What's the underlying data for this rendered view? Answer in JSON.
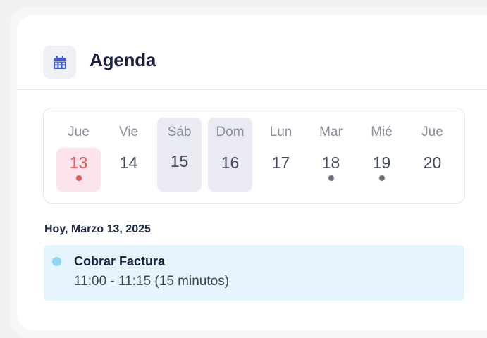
{
  "header": {
    "title": "Agenda",
    "icon": "calendar-icon"
  },
  "week": {
    "days": [
      {
        "dow": "Jue",
        "num": "13",
        "today": true,
        "event": true
      },
      {
        "dow": "Vie",
        "num": "14"
      },
      {
        "dow": "Sáb",
        "num": "15",
        "selected": true
      },
      {
        "dow": "Dom",
        "num": "16",
        "selected": true
      },
      {
        "dow": "Lun",
        "num": "17"
      },
      {
        "dow": "Mar",
        "num": "18",
        "event": true
      },
      {
        "dow": "Mié",
        "num": "19",
        "event": true
      },
      {
        "dow": "Jue",
        "num": "20"
      }
    ]
  },
  "agenda": {
    "date_heading": "Hoy, Marzo 13, 2025",
    "events": [
      {
        "title": "Cobrar Factura",
        "time": "11:00 - 11:15 (15 minutos)"
      }
    ]
  },
  "colors": {
    "accent": "#3b5bdb",
    "today": "#e55656",
    "today_bg": "#fbe4ec",
    "selected_bg": "#e9eaf2",
    "event_bg": "#e5f4fd",
    "event_dot": "#8fd3f7"
  }
}
